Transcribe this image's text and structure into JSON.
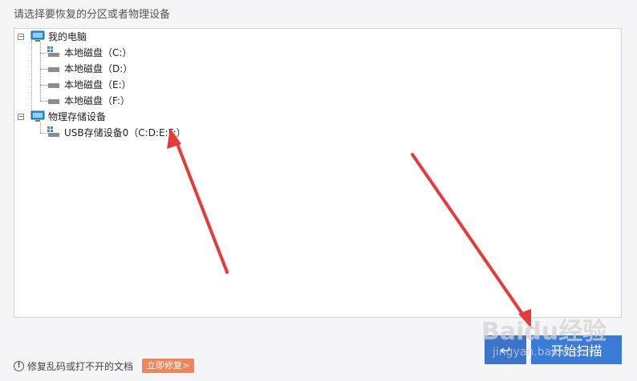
{
  "prompt_text": "请选择要恢复的分区或者物理设备",
  "tree": {
    "my_computer": {
      "label": "我的电脑",
      "drives": [
        {
          "label": "本地磁盘（C:）"
        },
        {
          "label": "本地磁盘（D:）"
        },
        {
          "label": "本地磁盘（E:）"
        },
        {
          "label": "本地磁盘（F:）"
        }
      ]
    },
    "physical_storage": {
      "label": "物理存储设备",
      "devices": [
        {
          "label": "USB存储设备0（C:D:E:F:）"
        }
      ]
    }
  },
  "footer": {
    "hint_text": "修复乱码或打不开的文档",
    "repair_button": "立即修复>"
  },
  "buttons": {
    "back_label": "↩",
    "scan_label": "开始扫描"
  },
  "watermark": {
    "brand": "Baidu经验",
    "url": "jingyan.baidu.com"
  },
  "colors": {
    "accent_blue": "#3a7bd5",
    "repair_orange": "#f0845a",
    "annotation_red": "#e83a3a"
  }
}
